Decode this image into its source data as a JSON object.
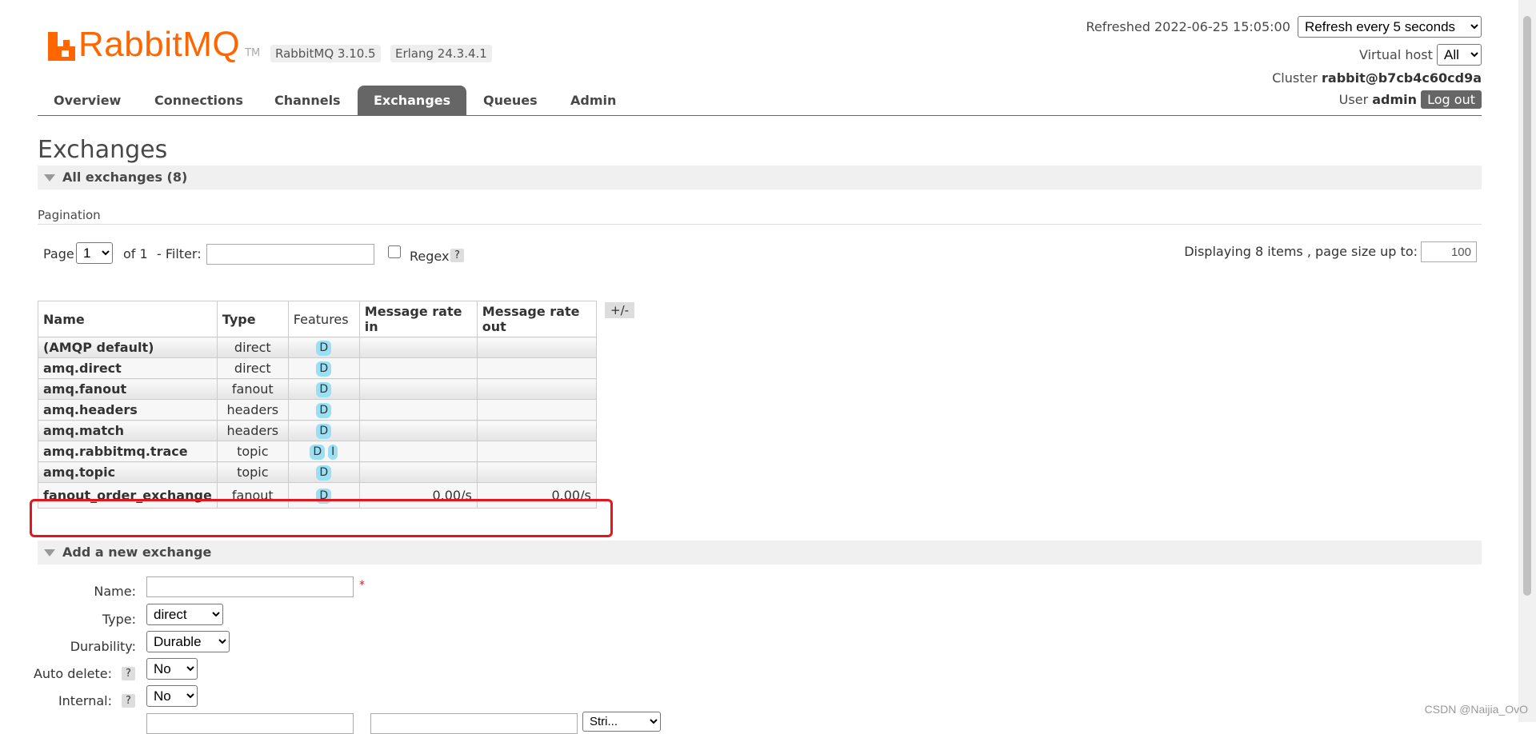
{
  "header": {
    "logo_text": "RabbitMQ",
    "logo_tm": "TM",
    "rabbitmq_version": "RabbitMQ 3.10.5",
    "erlang_version": "Erlang 24.3.4.1",
    "refreshed_text": "Refreshed 2022-06-25 15:05:00",
    "refresh_option": "Refresh every 5 seconds",
    "virtual_host_label": "Virtual host",
    "virtual_host_value": "All",
    "cluster_label": "Cluster",
    "cluster_value": "rabbit@b7cb4c60cd9a",
    "user_label": "User",
    "user_value": "admin",
    "logout_label": "Log out"
  },
  "tabs": [
    {
      "label": "Overview"
    },
    {
      "label": "Connections"
    },
    {
      "label": "Channels"
    },
    {
      "label": "Exchanges",
      "active": true
    },
    {
      "label": "Queues"
    },
    {
      "label": "Admin"
    }
  ],
  "page": {
    "title": "Exchanges",
    "all_exchanges_label": "All exchanges (8)",
    "pagination_label": "Pagination",
    "page_label": "Page",
    "page_value": "1",
    "of_text": "of 1",
    "filter_label": "- Filter:",
    "filter_value": "",
    "regex_label": "Regex",
    "help_glyph": "?",
    "display_text": "Displaying 8 items , page size up to:",
    "page_size_value": "100"
  },
  "table": {
    "columns": [
      "Name",
      "Type",
      "Features",
      "Message rate in",
      "Message rate out"
    ],
    "plus_minus": "+/-",
    "rows": [
      {
        "name": "(AMQP default)",
        "type": "direct",
        "features": [
          "D"
        ],
        "rate_in": "",
        "rate_out": ""
      },
      {
        "name": "amq.direct",
        "type": "direct",
        "features": [
          "D"
        ],
        "rate_in": "",
        "rate_out": ""
      },
      {
        "name": "amq.fanout",
        "type": "fanout",
        "features": [
          "D"
        ],
        "rate_in": "",
        "rate_out": ""
      },
      {
        "name": "amq.headers",
        "type": "headers",
        "features": [
          "D"
        ],
        "rate_in": "",
        "rate_out": ""
      },
      {
        "name": "amq.match",
        "type": "headers",
        "features": [
          "D"
        ],
        "rate_in": "",
        "rate_out": ""
      },
      {
        "name": "amq.rabbitmq.trace",
        "type": "topic",
        "features": [
          "D",
          "I"
        ],
        "rate_in": "",
        "rate_out": ""
      },
      {
        "name": "amq.topic",
        "type": "topic",
        "features": [
          "D"
        ],
        "rate_in": "",
        "rate_out": ""
      },
      {
        "name": "fanout_order_exchange",
        "type": "fanout",
        "features": [
          "D"
        ],
        "rate_in": "0.00/s",
        "rate_out": "0.00/s"
      }
    ]
  },
  "add_exchange": {
    "section_label": "Add a new exchange",
    "name_label": "Name:",
    "name_value": "",
    "required_mark": "*",
    "type_label": "Type:",
    "type_value": "direct",
    "durability_label": "Durability:",
    "durability_value": "Durable",
    "auto_delete_label": "Auto delete:",
    "auto_delete_value": "No",
    "internal_label": "Internal:",
    "internal_value": "No",
    "partial_select_value": "Stri..."
  },
  "watermark": "CSDN @Naijia_OvO",
  "colors": {
    "brand_orange": "#ff6600",
    "highlight_red": "#e8141c",
    "active_tab": "#666666",
    "feature_badge": "#99e0f5"
  }
}
